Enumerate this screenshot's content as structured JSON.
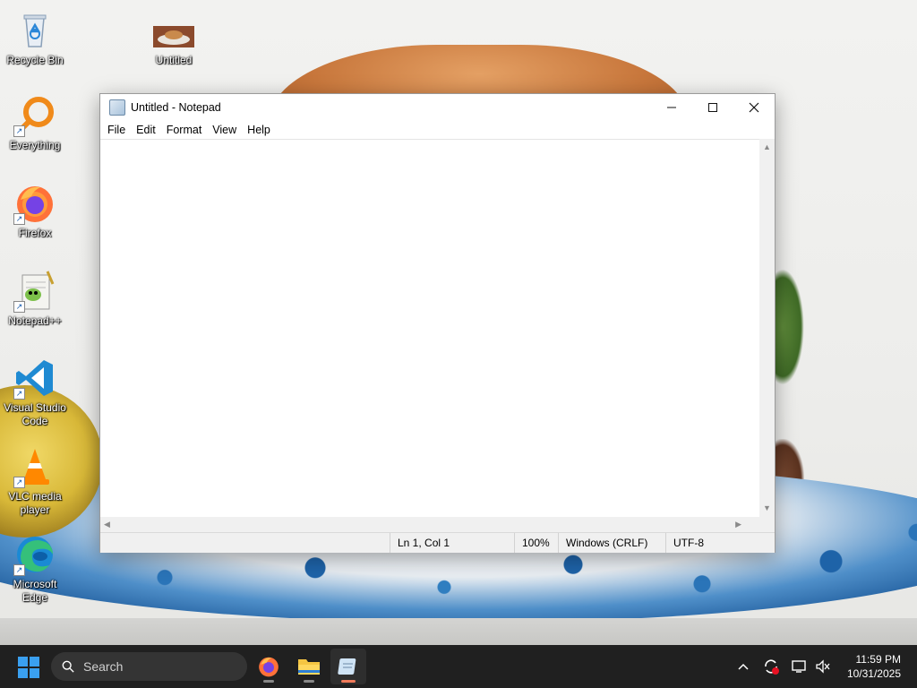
{
  "desktop": {
    "icons": [
      {
        "label": "Recycle Bin",
        "icon": "recycle-bin-icon"
      },
      {
        "label": "Untitled",
        "icon": "image-file-icon"
      },
      {
        "label": "Everything",
        "icon": "everything-search-icon"
      },
      {
        "label": "Firefox",
        "icon": "firefox-icon"
      },
      {
        "label": "Notepad++",
        "icon": "notepad-plus-plus-icon"
      },
      {
        "label": "Visual Studio Code",
        "icon": "vscode-icon"
      },
      {
        "label": "VLC media player",
        "icon": "vlc-icon"
      },
      {
        "label": "Microsoft Edge",
        "icon": "edge-icon"
      }
    ]
  },
  "notepad": {
    "title": "Untitled - Notepad",
    "menu": [
      "File",
      "Edit",
      "Format",
      "View",
      "Help"
    ],
    "content": "",
    "status": {
      "position": "Ln 1, Col 1",
      "zoom": "100%",
      "line_ending": "Windows (CRLF)",
      "encoding": "UTF-8"
    }
  },
  "taskbar": {
    "search_placeholder": "Search",
    "time": "11:59 PM",
    "date": "10/31/2025",
    "accent": "#f07a5a"
  }
}
